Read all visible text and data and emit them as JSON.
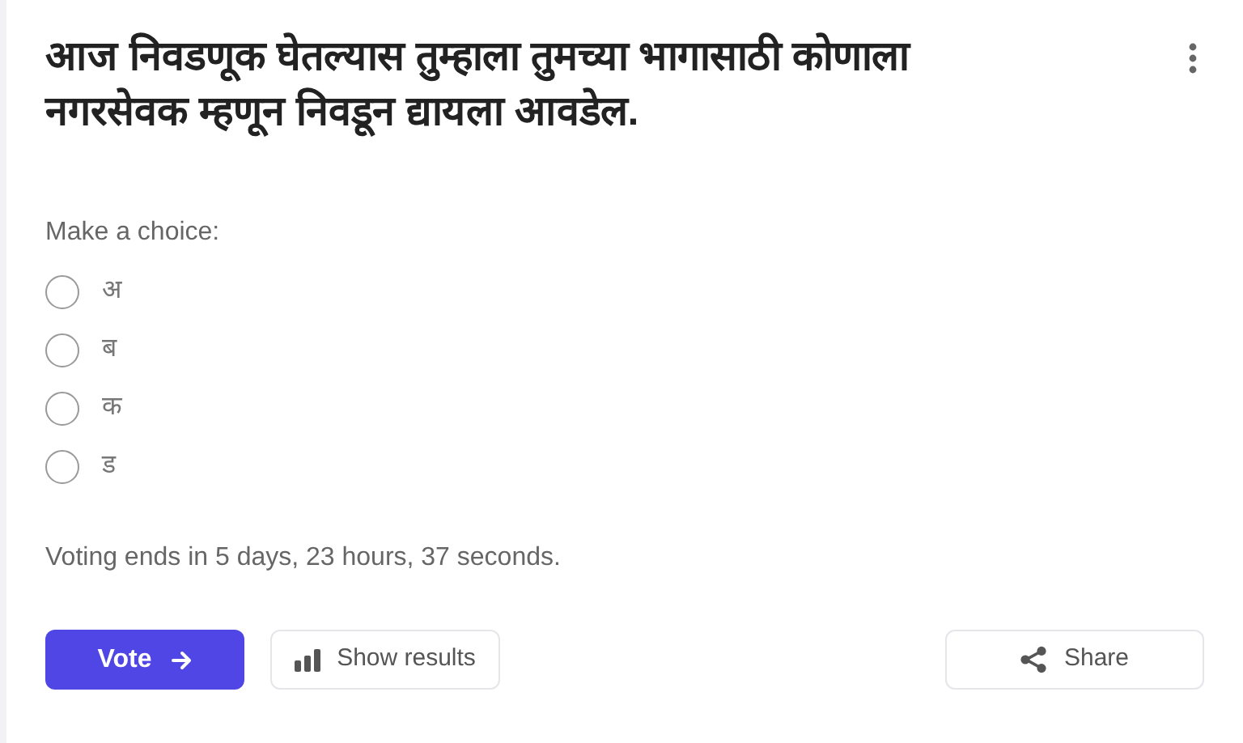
{
  "question": "आज निवडणूक घेतल्यास तुम्हाला तुमच्या भागासाठी कोणाला नगरसेवक म्हणून निवडून द्यायला आवडेल.",
  "prompt": "Make a choice:",
  "options": [
    {
      "label": "अ",
      "selected": false
    },
    {
      "label": "ब",
      "selected": false
    },
    {
      "label": "क",
      "selected": false
    },
    {
      "label": "ड",
      "selected": false
    }
  ],
  "deadline": "Voting ends in 5 days, 23 hours, 37 seconds.",
  "buttons": [
    {
      "kind": "vote",
      "label": "Vote"
    },
    {
      "kind": "results",
      "label": "Show results"
    },
    {
      "kind": "share",
      "label": "Share"
    }
  ]
}
